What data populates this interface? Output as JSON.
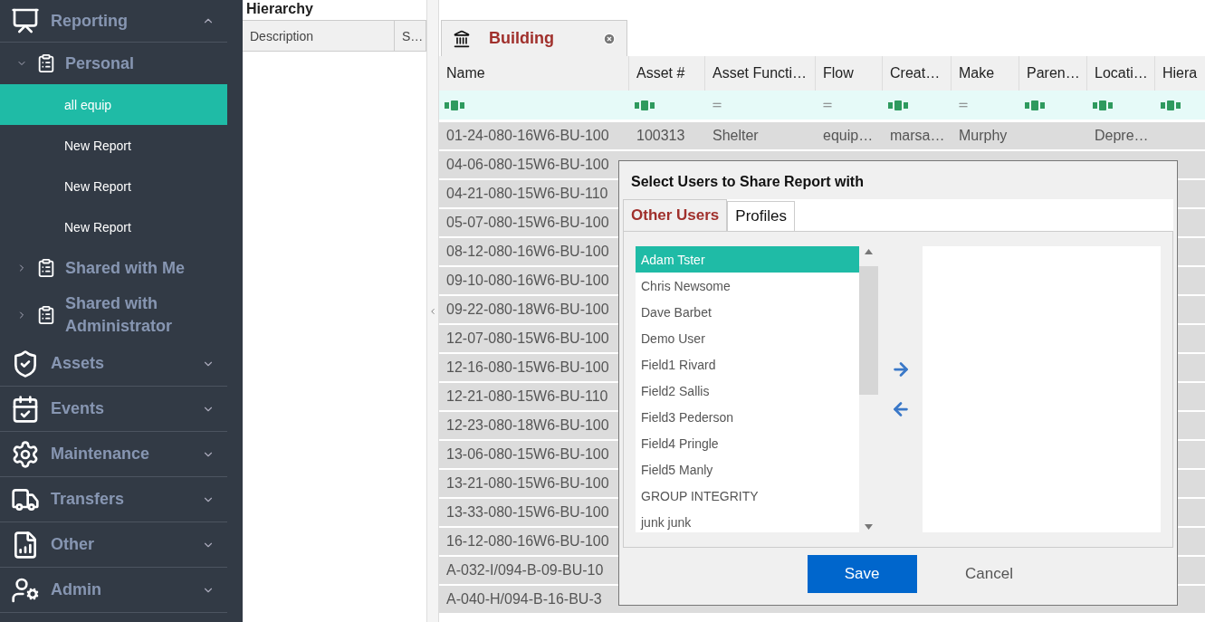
{
  "sidebar": {
    "items": [
      {
        "label": "Reporting",
        "expanded": true,
        "children": [
          {
            "label": "Personal",
            "expanded": true,
            "children": [
              {
                "label": "all equip",
                "selected": true
              },
              {
                "label": "New Report",
                "selected": false
              },
              {
                "label": "New Report",
                "selected": false
              },
              {
                "label": "New Report",
                "selected": false
              }
            ]
          },
          {
            "label": "Shared with Me",
            "expanded": false
          },
          {
            "label": "Shared with Administrator",
            "expanded": false
          }
        ]
      },
      {
        "label": "Assets",
        "expanded": false
      },
      {
        "label": "Events",
        "expanded": false
      },
      {
        "label": "Maintenance",
        "expanded": false
      },
      {
        "label": "Transfers",
        "expanded": false
      },
      {
        "label": "Other",
        "expanded": false
      },
      {
        "label": "Admin",
        "expanded": false
      }
    ]
  },
  "hierarchy_panel": {
    "title": "Hierarchy",
    "columns": [
      "Description",
      "S…"
    ]
  },
  "document_tab": {
    "label": "Building"
  },
  "table": {
    "columns": [
      {
        "label": "Name",
        "kind": "text"
      },
      {
        "label": "Asset #",
        "kind": "text"
      },
      {
        "label": "Asset Functi…",
        "kind": "equals"
      },
      {
        "label": "Flow",
        "kind": "equals"
      },
      {
        "label": "Creat…",
        "kind": "text"
      },
      {
        "label": "Make",
        "kind": "equals"
      },
      {
        "label": "Paren…",
        "kind": "text"
      },
      {
        "label": "Locati…",
        "kind": "text"
      },
      {
        "label": "Hiera",
        "kind": "text"
      }
    ],
    "rows": [
      {
        "cells": [
          "01-24-080-16W6-BU-100",
          "100313",
          "Shelter",
          "equip…",
          "marsa…",
          "Murphy",
          null,
          "Depre…"
        ]
      },
      {
        "cells": [
          "04-06-080-15W6-BU-100"
        ]
      },
      {
        "cells": [
          "04-21-080-15W6-BU-110"
        ]
      },
      {
        "cells": [
          "05-07-080-15W6-BU-100"
        ]
      },
      {
        "cells": [
          "08-12-080-16W6-BU-100"
        ]
      },
      {
        "cells": [
          "09-10-080-16W6-BU-100"
        ]
      },
      {
        "cells": [
          "09-22-080-18W6-BU-100"
        ]
      },
      {
        "cells": [
          "12-07-080-15W6-BU-100"
        ]
      },
      {
        "cells": [
          "12-16-080-15W6-BU-100"
        ]
      },
      {
        "cells": [
          "12-21-080-15W6-BU-110"
        ]
      },
      {
        "cells": [
          "12-23-080-18W6-BU-100"
        ]
      },
      {
        "cells": [
          "13-06-080-15W6-BU-100"
        ]
      },
      {
        "cells": [
          "13-21-080-15W6-BU-100"
        ]
      },
      {
        "cells": [
          "13-33-080-15W6-BU-100"
        ]
      },
      {
        "cells": [
          "16-12-080-16W6-BU-100"
        ]
      },
      {
        "cells": [
          "A-032-I/094-B-09-BU-10"
        ]
      },
      {
        "cells": [
          "A-040-H/094-B-16-BU-3"
        ]
      }
    ]
  },
  "dialog": {
    "title": "Select Users to Share Report with",
    "tabs": [
      {
        "label": "Other Users",
        "selected": true
      },
      {
        "label": "Profiles",
        "selected": false
      }
    ],
    "users": [
      {
        "name": "Adam Tster",
        "selected": true
      },
      {
        "name": "Chris Newsome",
        "selected": false
      },
      {
        "name": "Dave Barbet",
        "selected": false
      },
      {
        "name": "Demo User",
        "selected": false
      },
      {
        "name": "Field1 Rivard",
        "selected": false
      },
      {
        "name": "Field2 Sallis",
        "selected": false
      },
      {
        "name": "Field3 Pederson",
        "selected": false
      },
      {
        "name": "Field4 Pringle",
        "selected": false
      },
      {
        "name": "Field5 Manly",
        "selected": false
      },
      {
        "name": "GROUP INTEGRITY",
        "selected": false
      },
      {
        "name": "junk junk",
        "selected": false
      }
    ],
    "save": "Save",
    "cancel": "Cancel"
  }
}
